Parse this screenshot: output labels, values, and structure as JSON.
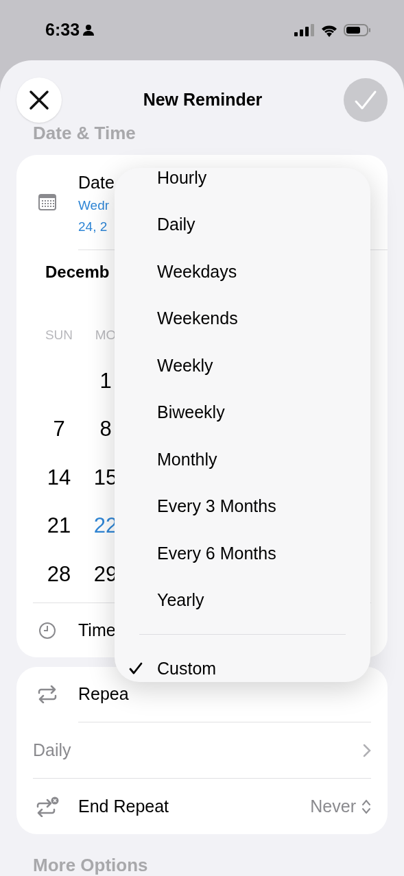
{
  "status_bar": {
    "time": "6:33"
  },
  "header": {
    "title": "New Reminder"
  },
  "section_title": "Date & Time",
  "date_row": {
    "label": "Date",
    "value_line_1": "Wedr",
    "value_line_2": "24, 2"
  },
  "calendar": {
    "month": "Decemb",
    "weekdays": [
      "SUN",
      "MO"
    ],
    "weeks": [
      {
        "mon": {
          "label": "1",
          "today": false
        }
      },
      {
        "sun": {
          "label": "7",
          "today": false
        },
        "mon": {
          "label": "8",
          "today": false
        }
      },
      {
        "sun": {
          "label": "14",
          "today": false
        },
        "mon": {
          "label": "15",
          "today": false
        }
      },
      {
        "sun": {
          "label": "21",
          "today": false
        },
        "mon": {
          "label": "22",
          "today": true
        }
      },
      {
        "sun": {
          "label": "28",
          "today": false
        },
        "mon": {
          "label": "29",
          "today": false
        }
      }
    ]
  },
  "time_row": {
    "label": "Time"
  },
  "repeat_card": {
    "repeat_label": "Repea",
    "frequency": "Daily",
    "end_repeat_label": "End Repeat",
    "end_repeat_value": "Never"
  },
  "more_options": "More Options",
  "menu": {
    "sections": [
      {
        "items": [
          {
            "label": "Hourly",
            "selected": false
          },
          {
            "label": "Daily",
            "selected": false
          },
          {
            "label": "Weekdays",
            "selected": false
          },
          {
            "label": "Weekends",
            "selected": false
          },
          {
            "label": "Weekly",
            "selected": false
          },
          {
            "label": "Biweekly",
            "selected": false
          },
          {
            "label": "Monthly",
            "selected": false
          },
          {
            "label": "Every 3 Months",
            "selected": false
          },
          {
            "label": "Every 6 Months",
            "selected": false
          },
          {
            "label": "Yearly",
            "selected": false
          }
        ]
      },
      {
        "items": [
          {
            "label": "Custom",
            "selected": true
          }
        ]
      }
    ]
  }
}
